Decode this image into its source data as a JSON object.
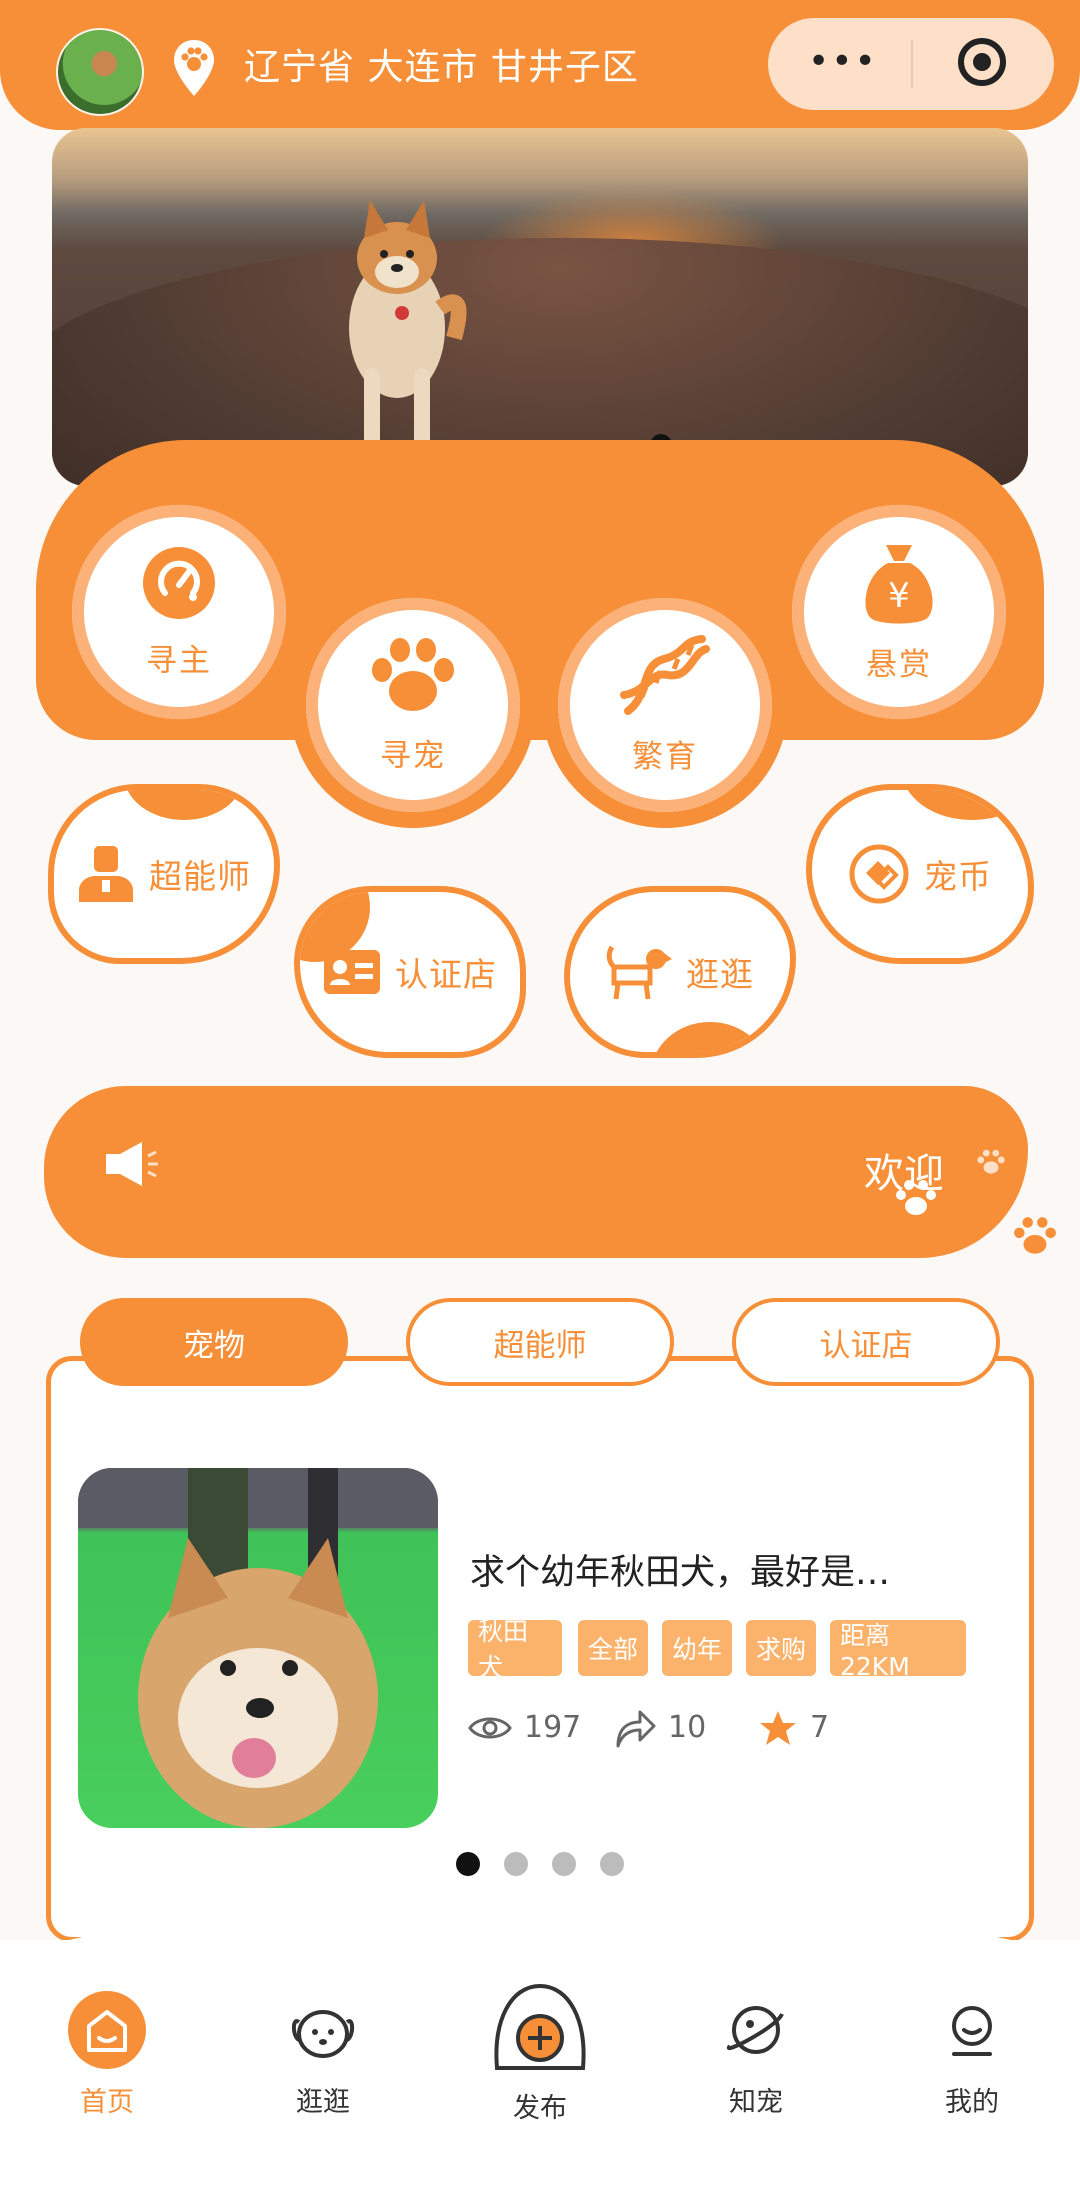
{
  "header": {
    "location": "辽宁省 大连市 甘井子区",
    "more_glyph": "•••"
  },
  "banner": {
    "total_slides": 1,
    "current_slide": 1
  },
  "features": {
    "owner": "寻主",
    "pet": "寻宠",
    "breed": "繁育",
    "reward": "悬赏",
    "reward_symbol": "¥",
    "super_trainer": "超能师",
    "certified_shop": "认证店",
    "browse": "逛逛",
    "coin": "宠币"
  },
  "notice": {
    "text": "欢迎"
  },
  "tabs": [
    {
      "label": "宠物",
      "active": true
    },
    {
      "label": "超能师",
      "active": false
    },
    {
      "label": "认证店",
      "active": false
    }
  ],
  "card": {
    "title": "求个幼年秋田犬，最好是…",
    "tags": [
      "秋田犬",
      "全部",
      "幼年",
      "求购",
      "距离22KM"
    ],
    "views": "197",
    "shares": "10",
    "favorites": "7",
    "carousel_total": 4,
    "carousel_current": 1
  },
  "nav": [
    {
      "label": "首页",
      "icon": "home-icon",
      "active": true
    },
    {
      "label": "逛逛",
      "icon": "dog-face-icon",
      "active": false
    },
    {
      "label": "发布",
      "icon": "plus-circle-icon",
      "active": false
    },
    {
      "label": "知宠",
      "icon": "planet-icon",
      "active": false
    },
    {
      "label": "我的",
      "icon": "user-icon",
      "active": false
    }
  ],
  "colors": {
    "accent": "#f68f37",
    "accent_light": "#fbb26b",
    "background": "#fcf8f5"
  }
}
